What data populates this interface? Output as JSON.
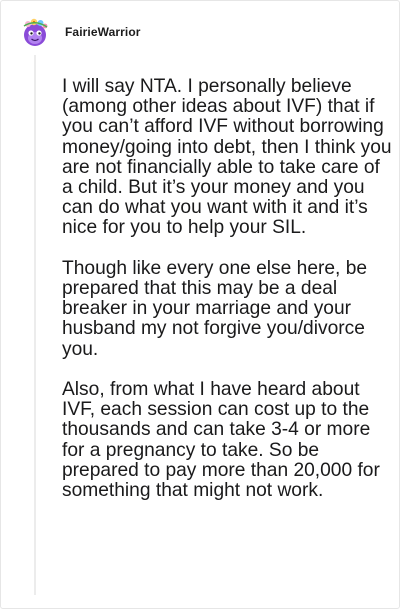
{
  "comment": {
    "username": "FairieWarrior",
    "avatar_icon": "purple-creature-with-flower-crown-avatar",
    "paragraphs": [
      "I will say NTA. I personally believe (among other ideas about IVF) that if you can’t afford IVF without borrowing money/going into debt, then I think you are not financially able to take care of a child. But it’s your money and you can do what you want with it and it’s nice for you to help your SIL.",
      "Though like every one else here, be prepared that this may be a deal breaker in your marriage and your husband my not forgive you/divorce you.",
      "Also, from what I have heard about IVF, each session can cost up to the thousands and can take 3-4 or more for a pregnancy to take. So be prepared to pay more than 20,000 for something that might not work."
    ]
  },
  "colors": {
    "username": "#1c1c1c",
    "text": "#1a1a1b",
    "thread_line": "#ececec",
    "avatar_purple": "#8a4bd8"
  }
}
